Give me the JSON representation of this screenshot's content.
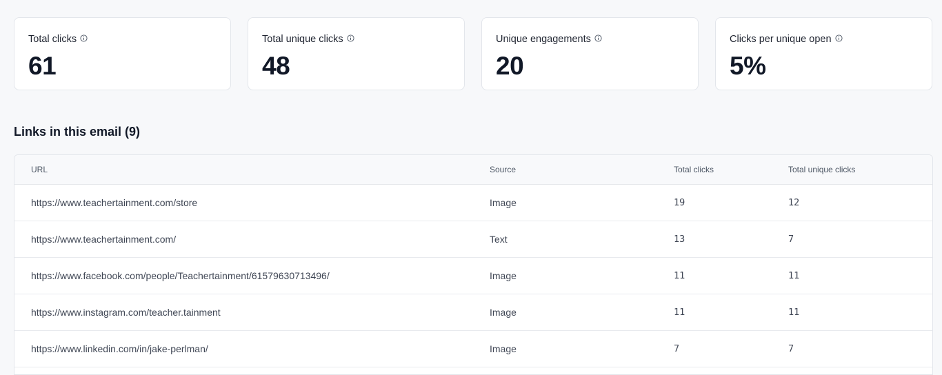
{
  "stats": [
    {
      "label": "Total clicks",
      "value": "61"
    },
    {
      "label": "Total unique clicks",
      "value": "48"
    },
    {
      "label": "Unique engagements",
      "value": "20"
    },
    {
      "label": "Clicks per unique open",
      "value": "5%"
    }
  ],
  "links_section": {
    "title": "Links in this email (9)",
    "columns": {
      "url": "URL",
      "source": "Source",
      "total_clicks": "Total clicks",
      "total_unique_clicks": "Total unique clicks"
    },
    "rows": [
      {
        "url": "https://www.teachertainment.com/store",
        "source": "Image",
        "total_clicks": "19",
        "total_unique_clicks": "12"
      },
      {
        "url": "https://www.teachertainment.com/",
        "source": "Text",
        "total_clicks": "13",
        "total_unique_clicks": "7"
      },
      {
        "url": "https://www.facebook.com/people/Teachertainment/61579630713496/",
        "source": "Image",
        "total_clicks": "11",
        "total_unique_clicks": "11"
      },
      {
        "url": "https://www.instagram.com/teacher.tainment",
        "source": "Image",
        "total_clicks": "11",
        "total_unique_clicks": "11"
      },
      {
        "url": "https://www.linkedin.com/in/jake-perlman/",
        "source": "Image",
        "total_clicks": "7",
        "total_unique_clicks": "7"
      }
    ]
  },
  "colors": {
    "background": "#f7f8fa",
    "card": "#ffffff",
    "border": "#e3e6eb",
    "text": "#111827"
  },
  "icons": {
    "stat_info": "info-icon"
  }
}
